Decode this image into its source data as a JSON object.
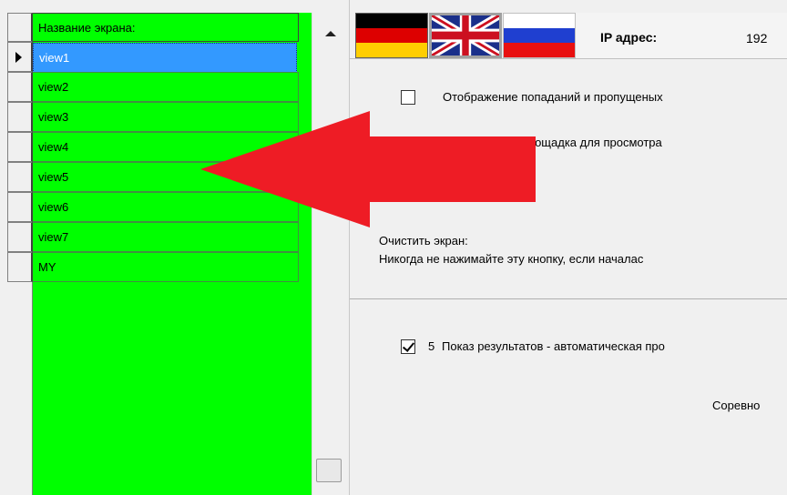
{
  "grid": {
    "header": "Название экрана:",
    "rows": [
      "view1",
      "view2",
      "view3",
      "view4",
      "view5",
      "view6",
      "view7",
      "MY"
    ],
    "selected_index": 0
  },
  "flags": [
    {
      "name": "german-flag-icon"
    },
    {
      "name": "uk-flag-icon"
    },
    {
      "name": "russian-flag-icon"
    }
  ],
  "ip": {
    "label": "IP адрес:",
    "value": "192"
  },
  "options": {
    "show_hits_label": "Отображение попаданий и пропущеных",
    "show_hits_checked": false,
    "viewing_area_label": "Площадка для просмотра",
    "clear_screen_label": "Очистить экран:",
    "clear_screen_warning": "Никогда не нажимайте эту кнопку, если началас",
    "show_results_label": "Показ результатов - автоматическая про",
    "show_results_prefix": "5",
    "show_results_checked": true,
    "competition_label": "Соревно"
  },
  "colors": {
    "grid_background": "#00ff00",
    "selection": "#3399ff",
    "annotation_arrow": "#ee1c25"
  }
}
